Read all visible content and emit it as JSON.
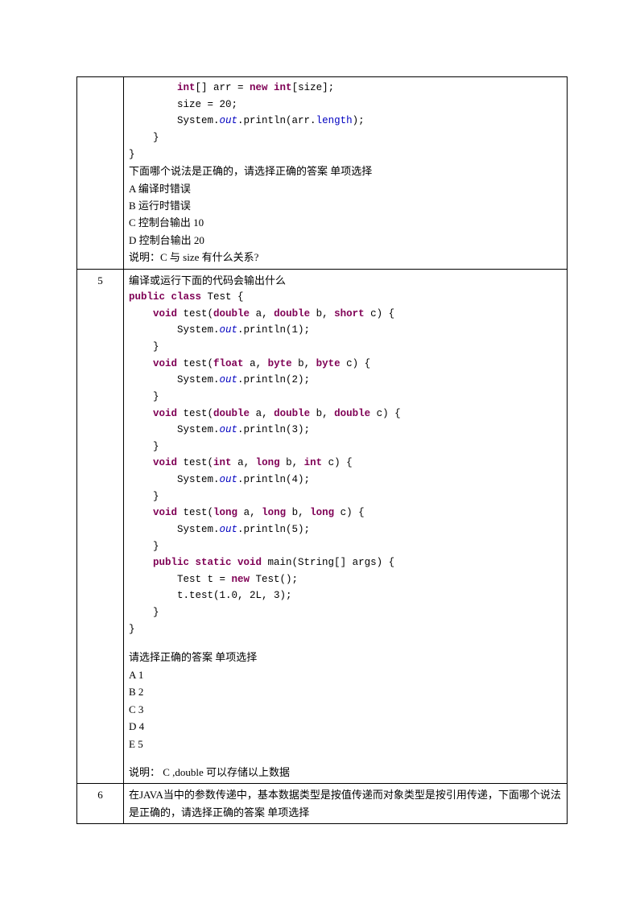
{
  "r1": {
    "q_prompt": "下面哪个说法是正确的，请选择正确的答案   单项选择",
    "optA": "A  编译时错误",
    "optB": "B  运行时错误",
    "optC": "C  控制台输出 10",
    "optD": "D  控制台输出 20",
    "note": "说明：C      与 size 有什么关系?"
  },
  "r2": {
    "num": "5",
    "q_intro": "编译或运行下面的代码会输出什么",
    "q_prompt": "请选择正确的答案   单项选择",
    "optA": "A    1",
    "optB": "B    2",
    "optC": "C    3",
    "optD": "D    4",
    "optE": "E    5",
    "note": "说明：  C   ,double 可以存储以上数据"
  },
  "r3": {
    "num": "6",
    "q_intro": "在JAVA当中的参数传递中，基本数据类型是按值传递而对象类型是按引用传递，下面哪个说法是正确的，请选择正确的答案     单项选择"
  },
  "code4": {
    "l1a": "        ",
    "l1_kw": "int",
    "l1b": "[] arr = ",
    "l1_kw2": "new int",
    "l1c": "[size];",
    "l2": "        size = 20;",
    "l3a": "        System.",
    "l3_out": "out",
    "l3b": ".println(arr.",
    "l3_len": "length",
    "l3c": ");",
    "l4": "    }",
    "l5": "}"
  },
  "code5": {
    "l1_kw": "public class",
    "l1b": " Test {",
    "l2a": "    ",
    "l2_kw": "void",
    "l2b": " test(",
    "l2_kw2": "double",
    "l2c": " a, ",
    "l2_kw3": "double",
    "l2d": " b, ",
    "l2_kw4": "short",
    "l2e": " c) {",
    "l3a": "        System.",
    "l3_out": "out",
    "l3b": ".println(1);",
    "l4": "    }",
    "l5a": "    ",
    "l5_kw": "void",
    "l5b": " test(",
    "l5_kw2": "float",
    "l5c": " a, ",
    "l5_kw3": "byte",
    "l5d": " b, ",
    "l5_kw4": "byte",
    "l5e": " c) {",
    "l6a": "        System.",
    "l6_out": "out",
    "l6b": ".println(2);",
    "l7": "    }",
    "l8a": "    ",
    "l8_kw": "void",
    "l8b": " test(",
    "l8_kw2": "double",
    "l8c": " a, ",
    "l8_kw3": "double",
    "l8d": " b, ",
    "l8_kw4": "double",
    "l8e": " c) {",
    "l9a": "        System.",
    "l9_out": "out",
    "l9b": ".println(3);",
    "l10": "    }",
    "l11a": "    ",
    "l11_kw": "void",
    "l11b": " test(",
    "l11_kw2": "int",
    "l11c": " a, ",
    "l11_kw3": "long",
    "l11d": " b, ",
    "l11_kw4": "int",
    "l11e": " c) {",
    "l12a": "        System.",
    "l12_out": "out",
    "l12b": ".println(4);",
    "l13": "    }",
    "l14a": "    ",
    "l14_kw": "void",
    "l14b": " test(",
    "l14_kw2": "long",
    "l14c": " a, ",
    "l14_kw3": "long",
    "l14d": " b, ",
    "l14_kw4": "long",
    "l14e": " c) {",
    "l15a": "        System.",
    "l15_out": "out",
    "l15b": ".println(5);",
    "l16": "    }",
    "l17a": "    ",
    "l17_kw": "public static void",
    "l17b": " main(String[] args) {",
    "l18a": "        Test t = ",
    "l18_kw": "new",
    "l18b": " Test();",
    "l19": "        t.test(1.0, 2L, 3);",
    "l20": "    }",
    "l21": "}"
  }
}
